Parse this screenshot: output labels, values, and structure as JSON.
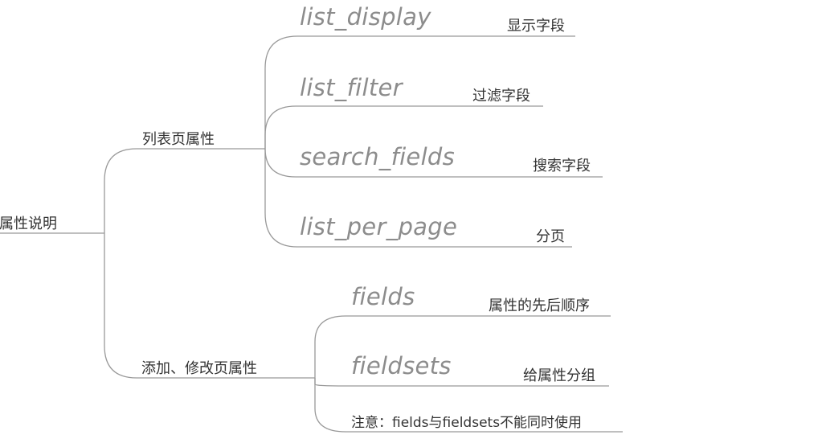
{
  "root": {
    "label": "属性说明"
  },
  "groups": [
    {
      "label": "列表页属性",
      "items": [
        {
          "code": "list_display",
          "desc": "显示字段"
        },
        {
          "code": "list_filter",
          "desc": "过滤字段"
        },
        {
          "code": "search_fields",
          "desc": "搜索字段"
        },
        {
          "code": "list_per_page",
          "desc": "分页"
        }
      ]
    },
    {
      "label": "添加、修改页属性",
      "items": [
        {
          "code": "fields",
          "desc": "属性的先后顺序"
        },
        {
          "code": "fieldsets",
          "desc": "给属性分组"
        }
      ],
      "note": "注意：fields与fieldsets不能同时使用"
    }
  ],
  "colors": {
    "line": "#999999",
    "text": "#333333",
    "code": "#8c8c8c",
    "background": "#ffffff"
  }
}
